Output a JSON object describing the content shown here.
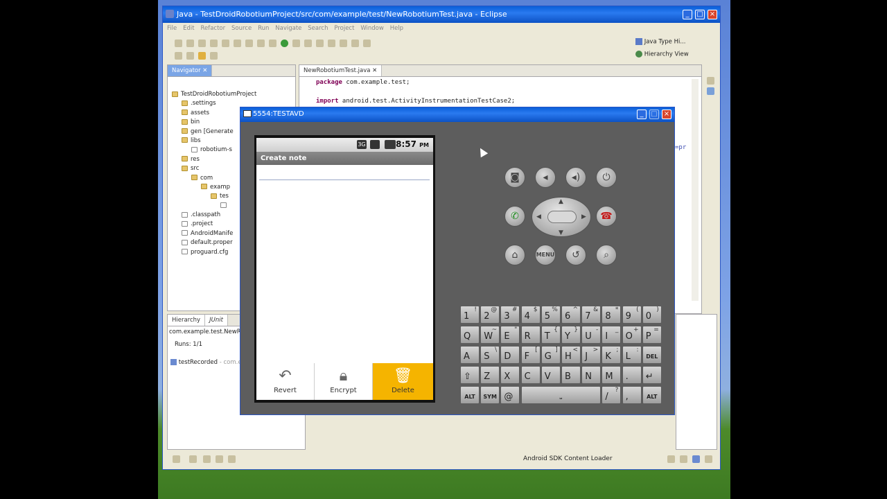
{
  "eclipse": {
    "title": "Java - TestDroidRobotiumProject/src/com/example/test/NewRobotiumTest.java - Eclipse",
    "menu": [
      "File",
      "Edit",
      "Refactor",
      "Source",
      "Run",
      "Navigate",
      "Search",
      "Project",
      "Window",
      "Help"
    ],
    "perspectives": {
      "java_type_hierarchy": "Java Type Hi...",
      "hierarchy_view": "Hierarchy View"
    },
    "navigator": {
      "tab_label": "Navigator",
      "tree": [
        {
          "label": "TestDroidRobotiumProject",
          "depth": 0,
          "kind": "project"
        },
        {
          "label": ".settings",
          "depth": 1,
          "kind": "folder"
        },
        {
          "label": "assets",
          "depth": 1,
          "kind": "folder"
        },
        {
          "label": "bin",
          "depth": 1,
          "kind": "folder"
        },
        {
          "label": "gen [Generate",
          "depth": 1,
          "kind": "folder"
        },
        {
          "label": "libs",
          "depth": 1,
          "kind": "folder"
        },
        {
          "label": "robotium-s",
          "depth": 2,
          "kind": "file"
        },
        {
          "label": "res",
          "depth": 1,
          "kind": "folder"
        },
        {
          "label": "src",
          "depth": 1,
          "kind": "folder"
        },
        {
          "label": "com",
          "depth": 2,
          "kind": "folder"
        },
        {
          "label": "examp",
          "depth": 3,
          "kind": "folder"
        },
        {
          "label": "tes",
          "depth": 4,
          "kind": "folder"
        },
        {
          "label": "",
          "depth": 5,
          "kind": "file"
        },
        {
          "label": ".classpath",
          "depth": 1,
          "kind": "file"
        },
        {
          "label": ".project",
          "depth": 1,
          "kind": "file"
        },
        {
          "label": "AndroidManife",
          "depth": 1,
          "kind": "file"
        },
        {
          "label": "default.proper",
          "depth": 1,
          "kind": "file"
        },
        {
          "label": "proguard.cfg",
          "depth": 1,
          "kind": "file"
        }
      ]
    },
    "editor": {
      "tab_label": "NewRobotiumTest.java",
      "line1_kw": "package",
      "line1_rest": " com.example.test;",
      "line2_kw": "import",
      "line2_rest": " android.test.ActivityInstrumentationTestCase2;",
      "fragment": "=pr"
    },
    "junit": {
      "tab_hierarchy": "Hierarchy",
      "tab_junit": "JUnit",
      "test_class": "com.example.test.NewRobo",
      "runs": "Runs:  1/1",
      "test_name": "testRecorded",
      "test_suffix": " - com.ex"
    },
    "statusbar": {
      "message": "Android SDK Content Loader"
    }
  },
  "emulator": {
    "title": "5554:TESTAVD",
    "statusbar": {
      "network": "3G",
      "time": "8:57",
      "ampm": "PM"
    },
    "app_title": "Create note",
    "buttons": [
      {
        "label": "Revert",
        "icon": "undo-arrow-icon"
      },
      {
        "label": "Encrypt",
        "icon": "lock-icon"
      },
      {
        "label": "Delete",
        "icon": "trash-icon"
      }
    ],
    "hw_keys": {
      "menu": "MENU"
    },
    "keyboard": {
      "row1": [
        [
          "1",
          "!"
        ],
        [
          "2",
          "@"
        ],
        [
          "3",
          "#"
        ],
        [
          "4",
          "$"
        ],
        [
          "5",
          "%"
        ],
        [
          "6",
          "^"
        ],
        [
          "7",
          "&"
        ],
        [
          "8",
          "*"
        ],
        [
          "9",
          "("
        ],
        [
          "0",
          ")"
        ]
      ],
      "row2": [
        [
          "Q",
          ""
        ],
        [
          "W",
          "~"
        ],
        [
          "E",
          "\""
        ],
        [
          "R",
          ""
        ],
        [
          "T",
          "{"
        ],
        [
          "Y",
          "}"
        ],
        [
          "U",
          "-"
        ],
        [
          "I",
          "_"
        ],
        [
          "O",
          "+"
        ],
        [
          "P",
          "="
        ]
      ],
      "row3": [
        [
          "A",
          ""
        ],
        [
          "S",
          "\\"
        ],
        [
          "D",
          ""
        ],
        [
          "F",
          "["
        ],
        [
          "G",
          "]"
        ],
        [
          "H",
          "<"
        ],
        [
          "J",
          ">"
        ],
        [
          "K",
          ";"
        ],
        [
          "L",
          ":"
        ]
      ],
      "row3_del": "DEL",
      "row4": [
        [
          "Z",
          ""
        ],
        [
          "X",
          ""
        ],
        [
          "C",
          ""
        ],
        [
          "V",
          ""
        ],
        [
          "B",
          ""
        ],
        [
          "N",
          ""
        ],
        [
          "M",
          ""
        ],
        [
          ".",
          ""
        ]
      ],
      "row5": {
        "alt_left": "ALT",
        "sym": "SYM",
        "at": "@",
        "slash": "/",
        "question": "?",
        "comma": ",",
        "alt_right": "ALT"
      }
    },
    "colors": {
      "delete_bg": "#f5b400",
      "body_bg": "#5d5d5d"
    }
  }
}
